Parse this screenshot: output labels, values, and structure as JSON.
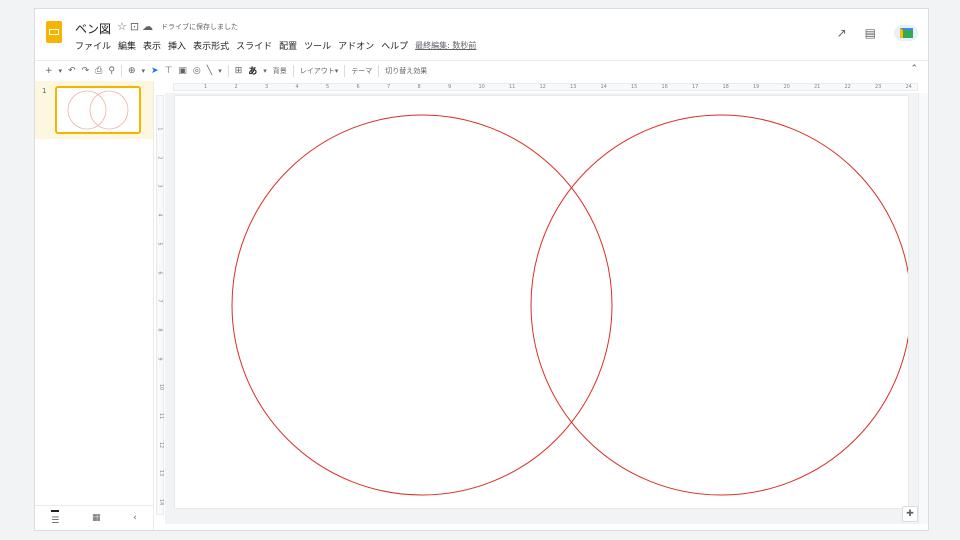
{
  "header": {
    "doc_title": "ベン図",
    "saved_status": "ドライブに保存しました",
    "menus": [
      "ファイル",
      "編集",
      "表示",
      "挿入",
      "表示形式",
      "スライド",
      "配置",
      "ツール",
      "アドオン",
      "ヘルプ"
    ],
    "last_edit": "最終編集: 数秒前"
  },
  "toolbar": {
    "background_label": "背景",
    "layout_label": "レイアウト▾",
    "theme_label": "テーマ",
    "transition_label": "切り替え効果"
  },
  "filmstrip": {
    "slide_number": "1"
  },
  "ruler": {
    "h_ticks": [
      "1",
      "2",
      "3",
      "4",
      "5",
      "6",
      "7",
      "8",
      "9",
      "10",
      "11",
      "12",
      "13",
      "14",
      "15",
      "16",
      "17",
      "18",
      "19",
      "20",
      "21",
      "22",
      "23",
      "24",
      "25"
    ],
    "v_ticks": [
      "1",
      "2",
      "3",
      "4",
      "5",
      "6",
      "7",
      "8",
      "9",
      "10",
      "11",
      "12",
      "13",
      "14"
    ]
  },
  "slide": {
    "circle_color": "#d93025",
    "shapes": [
      "left-circle",
      "right-circle"
    ]
  },
  "colors": {
    "accent": "#f4b400",
    "selection": "#1a73e8"
  }
}
